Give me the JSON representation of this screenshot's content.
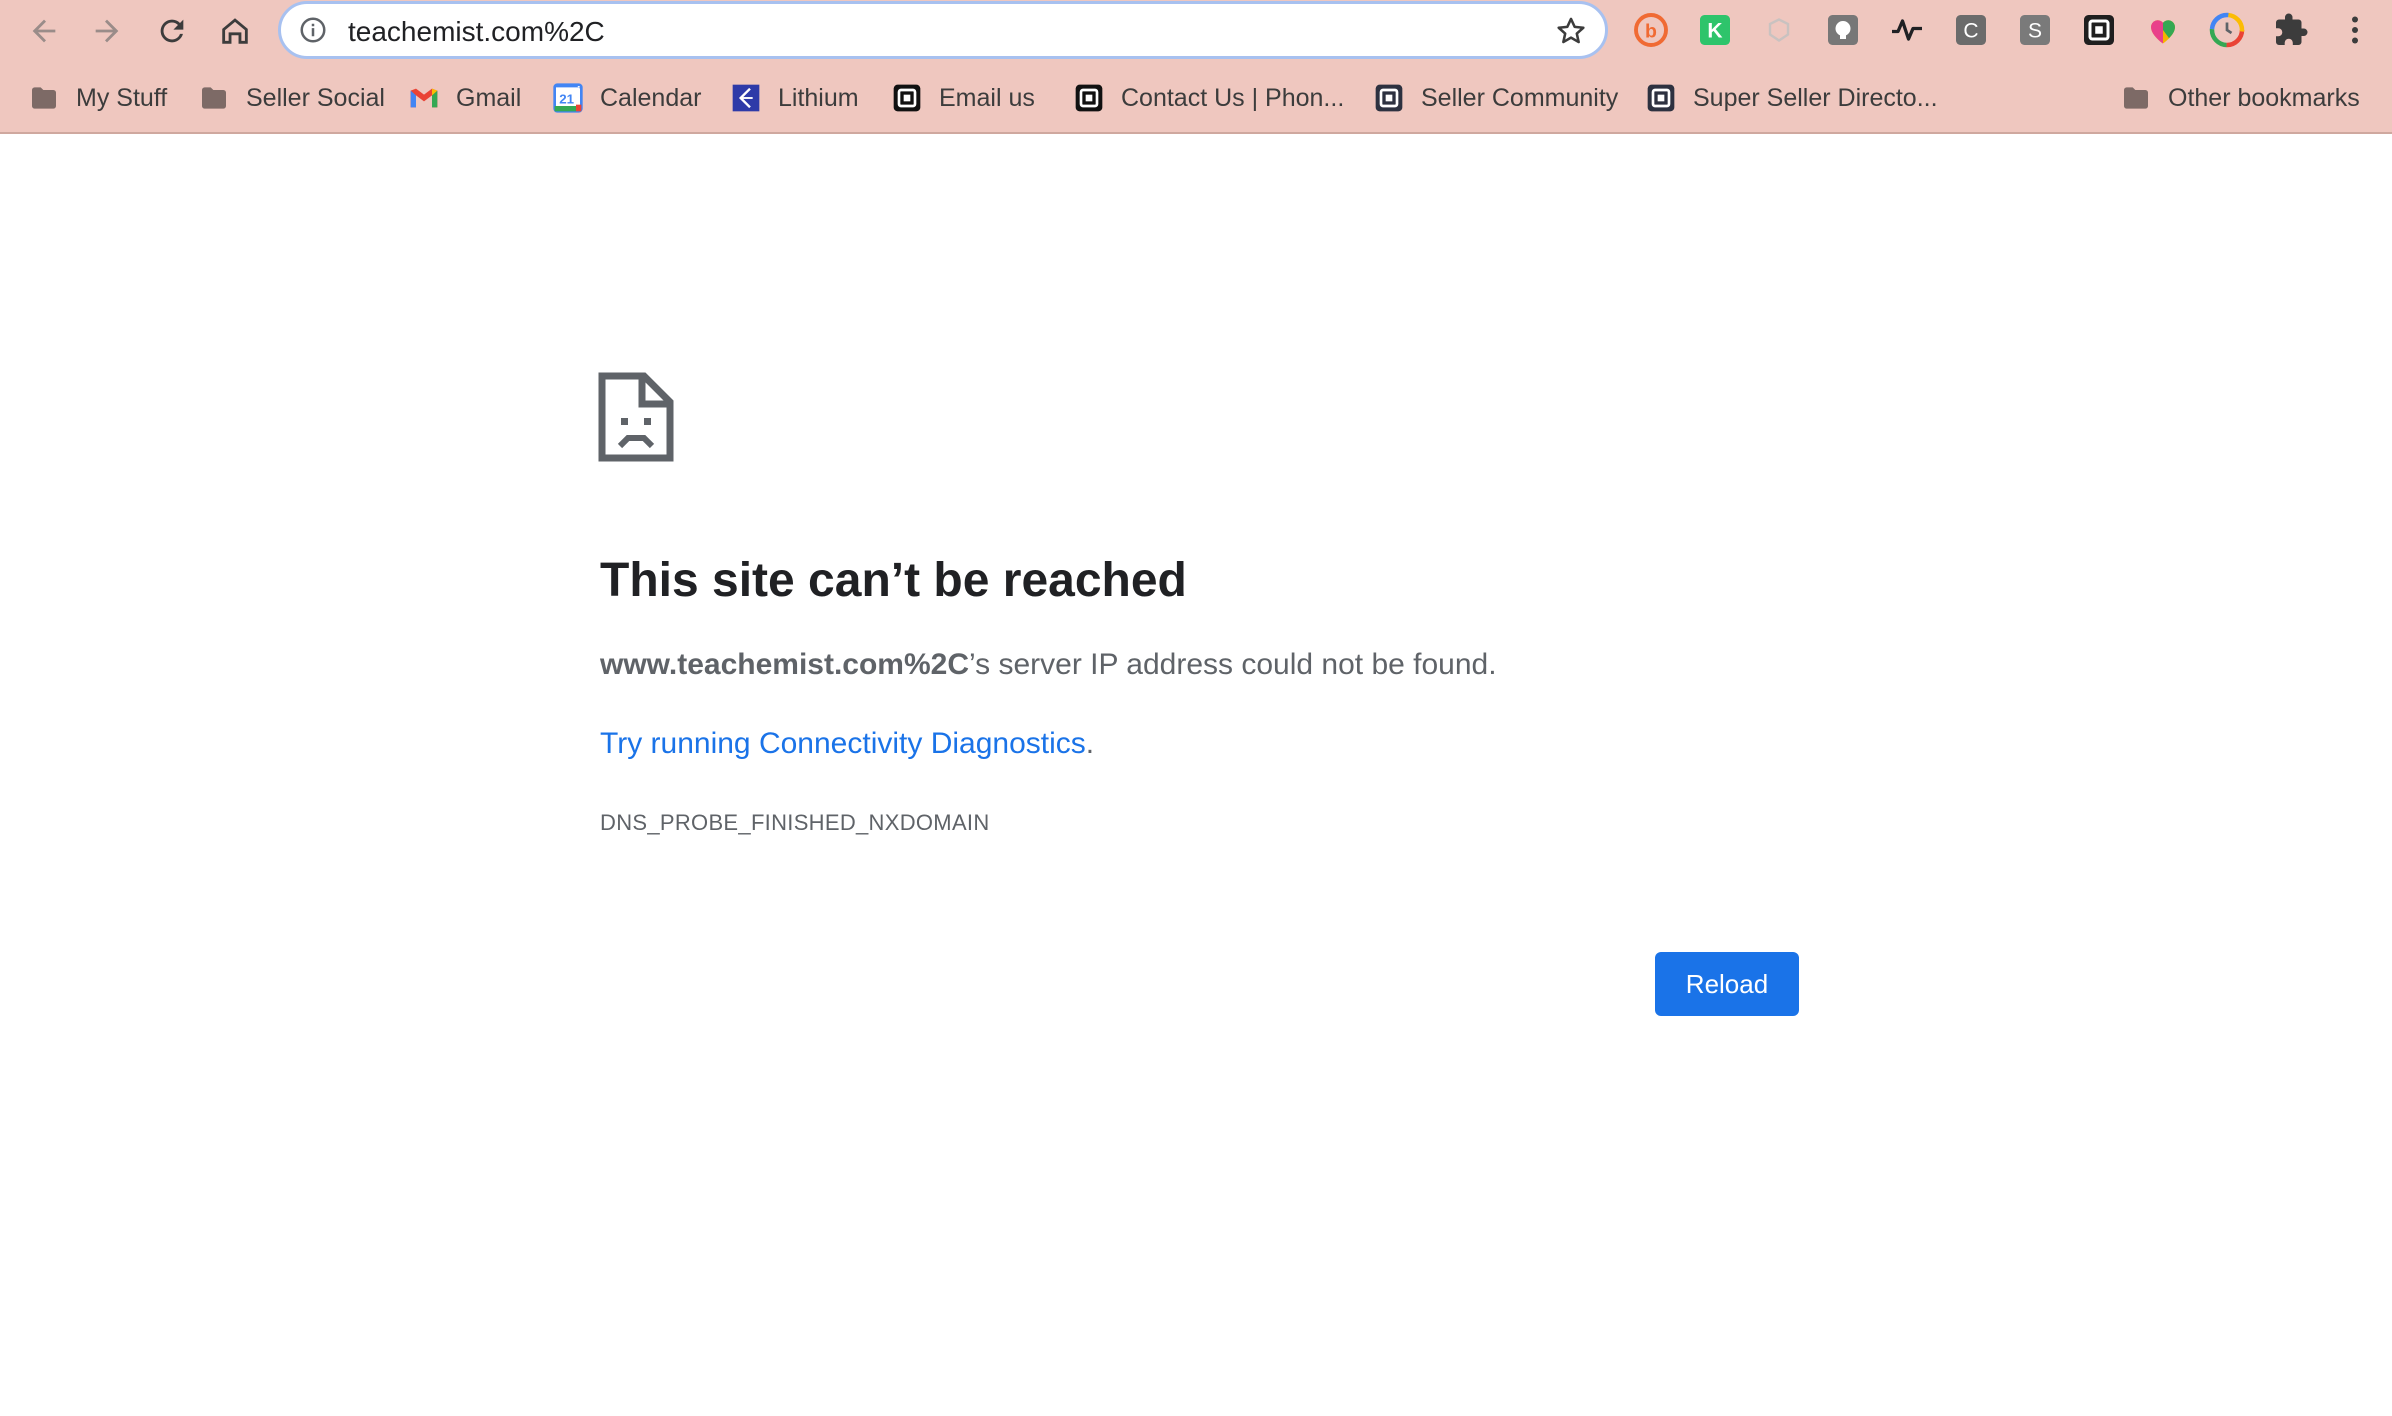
{
  "omnibox": {
    "url": "teachemist.com%2C"
  },
  "bookmarks": [
    {
      "label": "My Stuff",
      "icon": "folder-icon"
    },
    {
      "label": "Seller Social",
      "icon": "folder-icon"
    },
    {
      "label": "Gmail",
      "icon": "gmail-icon"
    },
    {
      "label": "Calendar",
      "icon": "calendar-icon"
    },
    {
      "label": "Lithium",
      "icon": "lithium-icon"
    },
    {
      "label": "Email us",
      "icon": "square-logo-icon"
    },
    {
      "label": "Contact Us | Phon...",
      "icon": "square-logo-icon"
    },
    {
      "label": "Seller Community",
      "icon": "square-logo-icon"
    },
    {
      "label": "Super Seller Directo...",
      "icon": "square-logo-icon"
    },
    {
      "label": "Other bookmarks",
      "icon": "folder-icon"
    }
  ],
  "extensions": {
    "k_label": "K",
    "c_label": "C",
    "s_label": "S"
  },
  "calendar_icon_day": "21",
  "error": {
    "title": "This site can’t be reached",
    "host": "www.teachemist.com%2C",
    "message_suffix": "’s server IP address could not be found.",
    "diagnostics_link": "Try running Connectivity Diagnostics",
    "diagnostics_suffix": ".",
    "code": "DNS_PROBE_FINISHED_NXDOMAIN",
    "reload_label": "Reload"
  },
  "colors": {
    "toolbar_bg": "#efc7bf",
    "link": "#1a73e8",
    "button": "#1a73e8"
  }
}
